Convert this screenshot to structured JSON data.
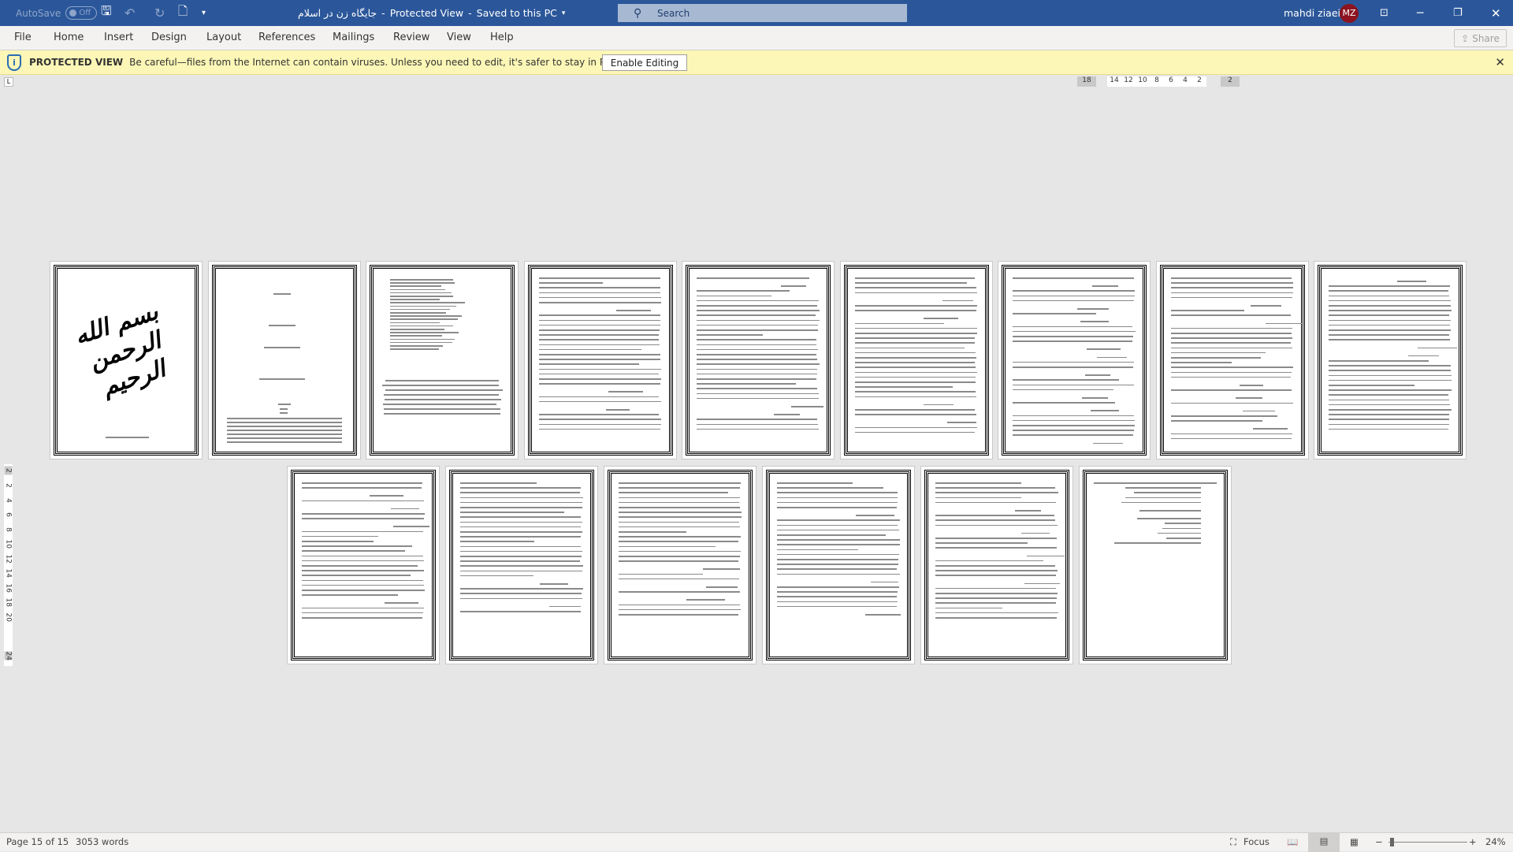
{
  "titlebar": {
    "autosave_label": "AutoSave",
    "autosave_state": "Off",
    "document_title": "جایگاه زن در اسلام",
    "mode": "Protected View",
    "save_status": "Saved to this PC",
    "search_placeholder": "Search",
    "user_name": "mahdi ziaei",
    "user_initials": "MZ",
    "accent": "#2b579a"
  },
  "ribbon": {
    "tabs": [
      "File",
      "Home",
      "Insert",
      "Design",
      "Layout",
      "References",
      "Mailings",
      "Review",
      "View",
      "Help"
    ],
    "share_label": "Share"
  },
  "protected_view": {
    "label": "PROTECTED VIEW",
    "message": "Be careful—files from the Internet can contain viruses. Unless you need to edit, it's safer to stay in Protected View.",
    "button": "Enable Editing",
    "bg": "#fcf7b6"
  },
  "ruler": {
    "horizontal": [
      "18",
      "14",
      "12",
      "10",
      "8",
      "6",
      "4",
      "2",
      "2"
    ],
    "vertical": [
      "2",
      "2",
      "4",
      "6",
      "8",
      "10",
      "12",
      "14",
      "16",
      "18",
      "20",
      "24"
    ]
  },
  "document": {
    "cover_calligraphy": "بسم الله الرحمن الرحیم",
    "page_count": 15
  },
  "status": {
    "page": "Page 15 of 15",
    "words": "3053 words",
    "focus": "Focus",
    "zoom": "24%",
    "zoom_percent": 24
  }
}
